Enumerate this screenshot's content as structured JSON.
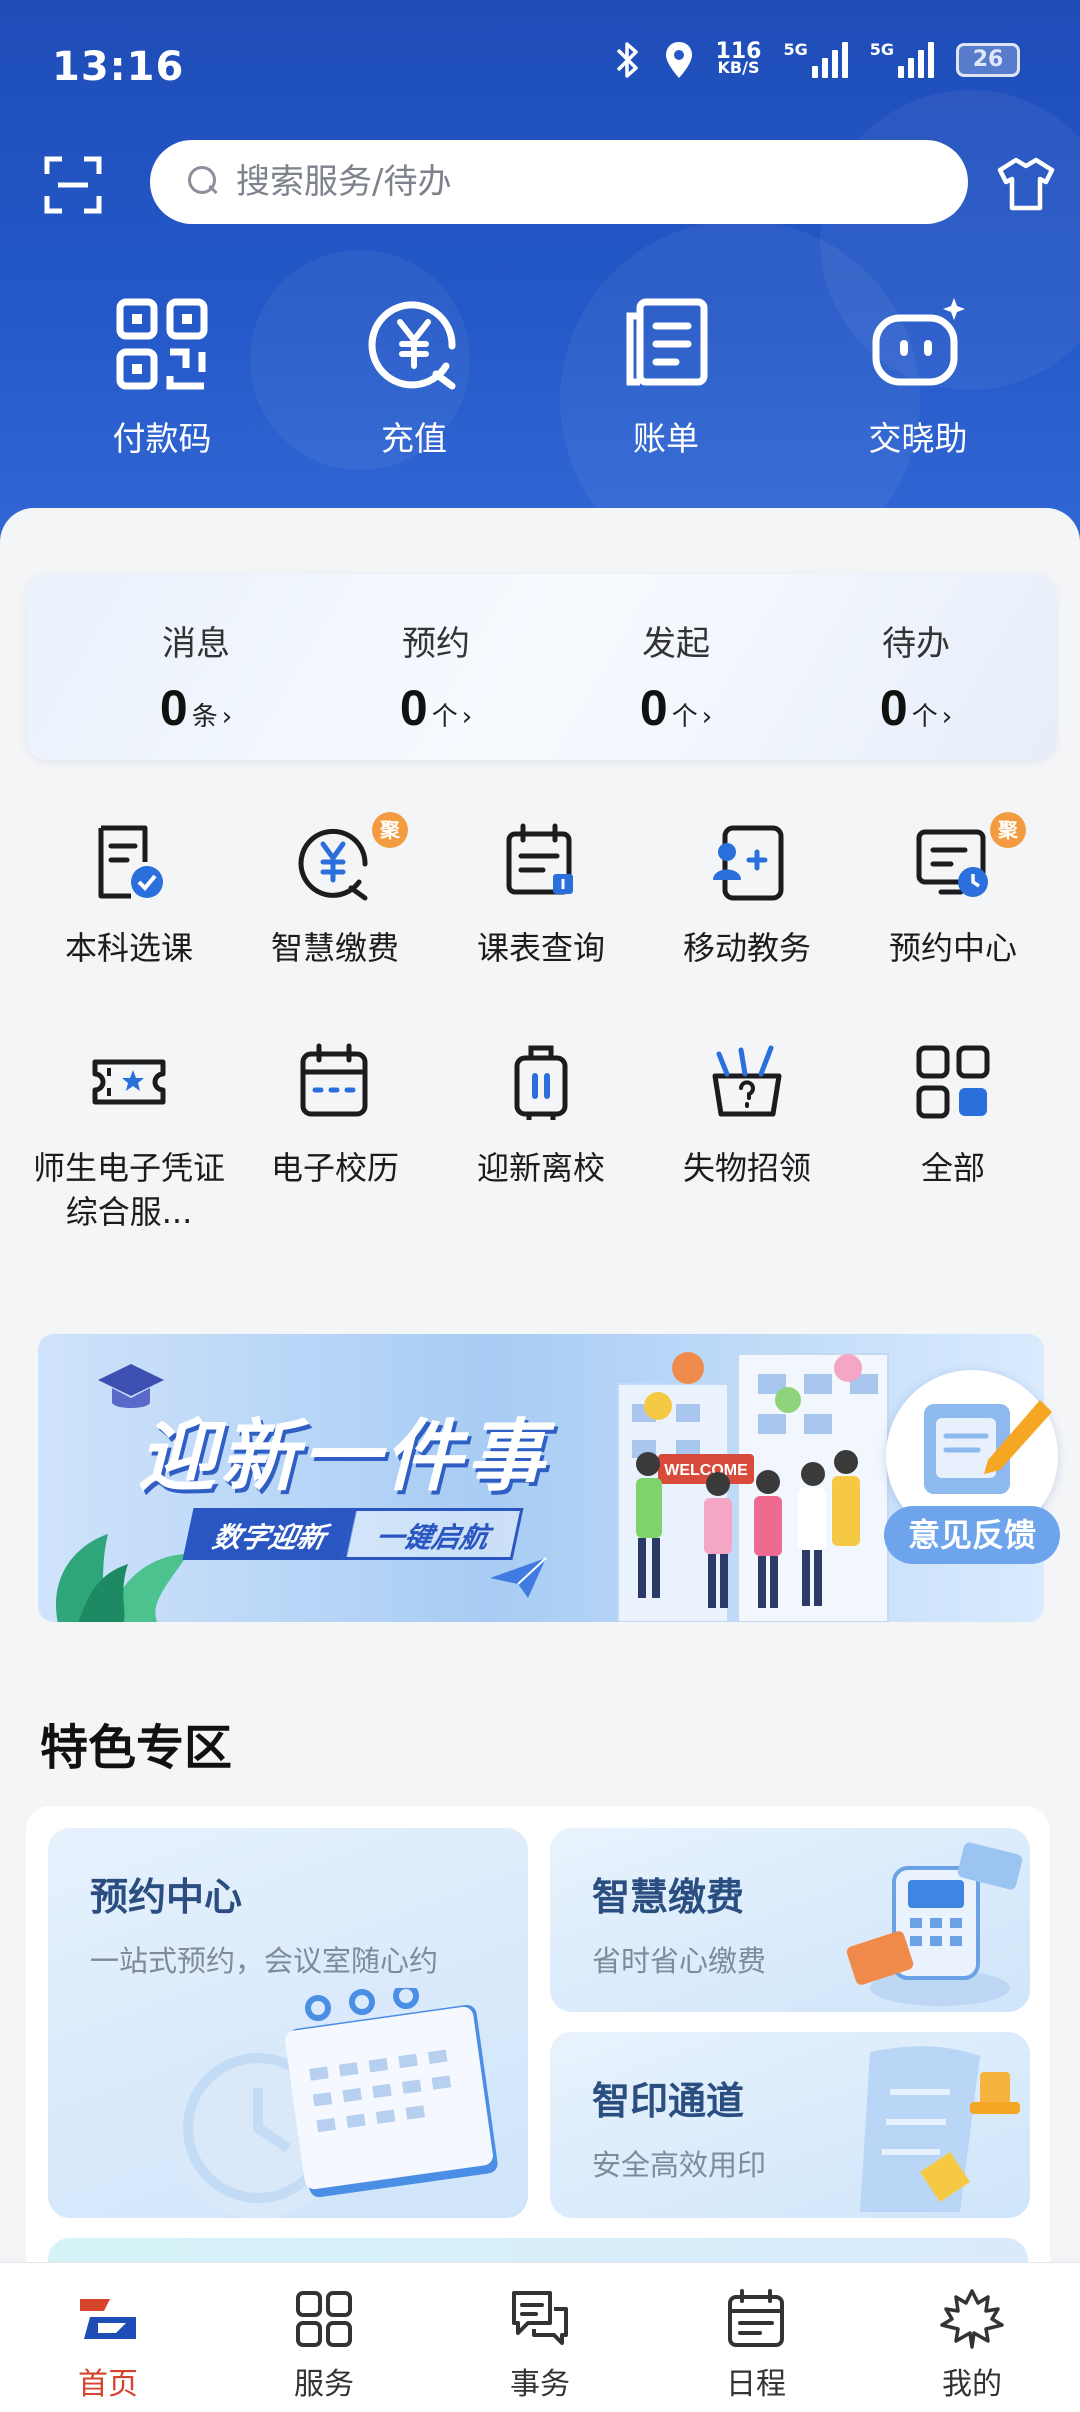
{
  "status_bar": {
    "time": "13:16",
    "net_speed_value": "116",
    "net_speed_unit": "KB/S",
    "signal1": "5G",
    "signal2": "5G",
    "battery": "26"
  },
  "search": {
    "placeholder": "搜索服务/待办"
  },
  "quick_actions": [
    {
      "label": "付款码",
      "icon": "qr-code-icon"
    },
    {
      "label": "充值",
      "icon": "yuan-recharge-icon"
    },
    {
      "label": "账单",
      "icon": "bill-icon"
    },
    {
      "label": "交晓助",
      "icon": "assistant-robot-icon"
    }
  ],
  "counters": [
    {
      "title": "消息",
      "value": "0",
      "unit": "条"
    },
    {
      "title": "预约",
      "value": "0",
      "unit": "个"
    },
    {
      "title": "发起",
      "value": "0",
      "unit": "个"
    },
    {
      "title": "待办",
      "value": "0",
      "unit": "个"
    }
  ],
  "services": [
    {
      "label": "本科选课",
      "icon": "course-select-icon",
      "badge": ""
    },
    {
      "label": "智慧缴费",
      "icon": "smart-payment-icon",
      "badge": "聚"
    },
    {
      "label": "课表查询",
      "icon": "timetable-icon",
      "badge": ""
    },
    {
      "label": "移动教务",
      "icon": "mobile-academic-icon",
      "badge": ""
    },
    {
      "label": "预约中心",
      "icon": "booking-center-icon",
      "badge": "聚"
    },
    {
      "label": "师生电子凭证综合服...",
      "icon": "e-credential-icon",
      "badge": ""
    },
    {
      "label": "电子校历",
      "icon": "calendar-icon",
      "badge": ""
    },
    {
      "label": "迎新离校",
      "icon": "luggage-icon",
      "badge": ""
    },
    {
      "label": "失物招领",
      "icon": "lost-found-icon",
      "badge": ""
    },
    {
      "label": "全部",
      "icon": "all-apps-icon",
      "badge": ""
    }
  ],
  "banner": {
    "title": "迎新一件事",
    "tag1": "数字迎新",
    "tag2": "一键启航",
    "sign": "WELCOME"
  },
  "feedback": {
    "label": "意见反馈"
  },
  "featured": {
    "title": "特色专区",
    "cards": [
      {
        "title": "预约中心",
        "subtitle": "一站式预约，会议室随心约"
      },
      {
        "title": "智慧缴费",
        "subtitle": "省时省心缴费"
      },
      {
        "title": "智印通道",
        "subtitle": "安全高效用印"
      }
    ]
  },
  "tabbar": [
    {
      "label": "首页",
      "icon": "home-icon",
      "active": true
    },
    {
      "label": "服务",
      "icon": "services-grid-icon",
      "active": false
    },
    {
      "label": "事务",
      "icon": "affairs-icon",
      "active": false
    },
    {
      "label": "日程",
      "icon": "schedule-icon",
      "active": false
    },
    {
      "label": "我的",
      "icon": "profile-maple-icon",
      "active": false
    }
  ],
  "colors": {
    "header_blue": "#2458c8",
    "accent_red": "#d6442c",
    "badge_orange": "#f39b40",
    "icon_blue": "#2a6fdb"
  }
}
